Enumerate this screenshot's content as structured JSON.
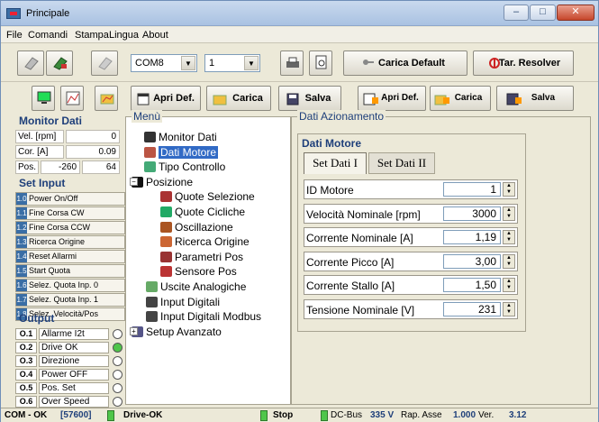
{
  "window": {
    "title": "Principale",
    "min_label": "–",
    "max_label": "□",
    "close_label": "✕"
  },
  "menu": [
    "File",
    "Comandi",
    "Stampa",
    "Lingua",
    "About"
  ],
  "toolbar1": {
    "com_port": "COM8",
    "com_index": "1",
    "carica_default": "Carica Default",
    "tar_resolver": "Tar. Resolver"
  },
  "toolbar2": {
    "apri_def": "Apri Def.",
    "carica": "Carica",
    "salva": "Salva",
    "apri_def2": "Apri Def.",
    "carica2": "Carica",
    "salva2": "Salva"
  },
  "monitor": {
    "title": "Monitor Dati",
    "vel_label": "Vel. [rpm]",
    "vel_value": "0",
    "cor_label": "Cor. [A]",
    "cor_value": "0.09",
    "pos_label": "Pos.",
    "pos_value1": "-260",
    "pos_value2": "64"
  },
  "inputs": {
    "title": "Set Input",
    "items": [
      {
        "n": "1.0",
        "t": "Power On/Off"
      },
      {
        "n": "1.1",
        "t": "Fine Corsa CW"
      },
      {
        "n": "1.2",
        "t": "Fine Corsa CCW"
      },
      {
        "n": "1.3",
        "t": "Ricerca Origine"
      },
      {
        "n": "1.4",
        "t": "Reset Allarmi"
      },
      {
        "n": "1.5",
        "t": "Start Quota"
      },
      {
        "n": "1.6",
        "t": "Selez. Quota Inp. 0"
      },
      {
        "n": "1.7",
        "t": "Selez. Quota Inp. 1"
      },
      {
        "n": "1.8",
        "t": "Selez. Velocità/Pos"
      }
    ]
  },
  "outputs": {
    "title": "Output",
    "items": [
      {
        "n": "O.1",
        "t": "Allarme I2t",
        "on": false
      },
      {
        "n": "O.2",
        "t": "Drive OK",
        "on": true
      },
      {
        "n": "O.3",
        "t": "Direzione",
        "on": false
      },
      {
        "n": "O.4",
        "t": "Power OFF",
        "on": false
      },
      {
        "n": "O.5",
        "t": "Pos. Set",
        "on": false
      },
      {
        "n": "O.6",
        "t": "Over Speed",
        "on": false
      }
    ]
  },
  "menu_panel": {
    "title": "Menù",
    "items": [
      "Monitor Dati",
      "Dati Motore",
      "Tipo Controllo",
      "Posizione",
      "Quote Selezione",
      "Quote Cicliche",
      "Oscillazione",
      "Ricerca Origine",
      "Parametri Pos",
      "Sensore Pos",
      "Uscite Analogiche",
      "Input Digitali",
      "Input Digitali Modbus",
      "Setup Avanzato"
    ],
    "tree_expander_minus": "−",
    "tree_expander_plus": "+"
  },
  "azionamento": {
    "title": "Dati Azionamento",
    "group_title": "Dati Motore",
    "tabs": [
      "Set Dati I",
      "Set Dati II"
    ],
    "fields": [
      {
        "label": "ID Motore",
        "value": "1"
      },
      {
        "label": "Velocità Nominale [rpm]",
        "value": "3000"
      },
      {
        "label": "Corrente Nominale [A]",
        "value": "1,19"
      },
      {
        "label": "Corrente Picco [A]",
        "value": "3,00"
      },
      {
        "label": "Corrente Stallo [A]",
        "value": "1,50"
      },
      {
        "label": "Tensione Nominale [V]",
        "value": "231"
      }
    ]
  },
  "statusbar": {
    "com": "COM - OK",
    "baud": "[57600]",
    "drive": "Drive-OK",
    "stop": "Stop",
    "dcbus_label": "DC-Bus",
    "dcbus_value": "335 V",
    "rap_label": "Rap. Asse",
    "rap_value": "1.000",
    "ver_label": "Ver.",
    "ver_value": "3.12"
  },
  "colors": {
    "accent": "#316ac5",
    "led_on": "#4fc64a",
    "title_blue": "#1e3f7a"
  }
}
